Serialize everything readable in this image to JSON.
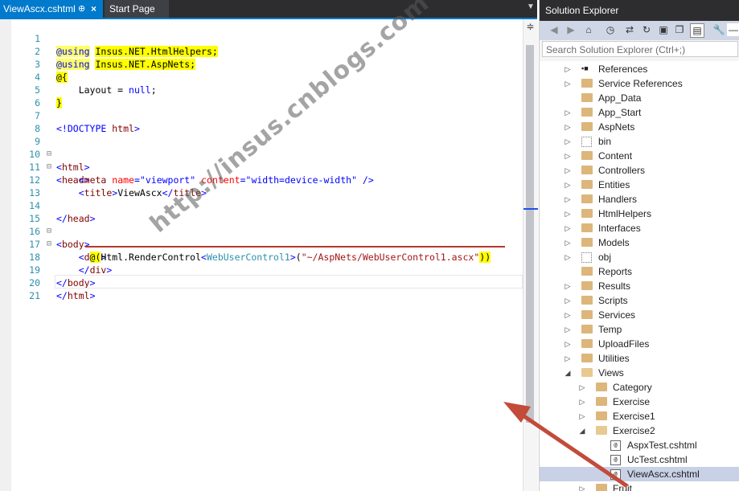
{
  "editor": {
    "active_tab": "ViewAscx.cshtml",
    "pin_glyph": "⊕",
    "close_glyph": "×",
    "second_tab": "Start Page",
    "split_glyph": "≑"
  },
  "code_lines": [
    {
      "n": "1"
    },
    {
      "n": "2"
    },
    {
      "n": "3"
    },
    {
      "n": "4"
    },
    {
      "n": "5"
    },
    {
      "n": "6"
    },
    {
      "n": "7"
    },
    {
      "n": "8"
    },
    {
      "n": "9"
    },
    {
      "n": "10"
    },
    {
      "n": "11"
    },
    {
      "n": "12"
    },
    {
      "n": "13"
    },
    {
      "n": "14"
    },
    {
      "n": "15"
    },
    {
      "n": "16"
    },
    {
      "n": "17"
    },
    {
      "n": "18"
    },
    {
      "n": "19"
    },
    {
      "n": "20"
    },
    {
      "n": "21"
    }
  ],
  "code": {
    "l1_kw": "@using",
    "l1_ns": "Insus.NET.HtmlHelpers;",
    "l2_kw": "@using",
    "l2_ns": "Insus.NET.AspNets;",
    "l3": "@{",
    "l4_a": "Layout = ",
    "l4_b": "null",
    "l4_c": ";",
    "l5": "}",
    "l7_a": "<!DOCTYPE ",
    "l7_b": "html",
    "l7_c": ">",
    "l9": "html",
    "l10": "head",
    "l11_tag": "meta",
    "l11_attr1": "name",
    "l11_val1": "\"viewport\"",
    "l11_attr2": "content",
    "l11_val2": "\"width=device-width\"",
    "l11_end": " />",
    "l12_tag": "title",
    "l12_text": "ViewAscx",
    "l14": "head",
    "l15": "body",
    "l16": "div",
    "l17_at": "@(",
    "l17_call": "Html.RenderControl",
    "l17_lt": "<",
    "l17_type": "WebUserControl1",
    "l17_gt": ">",
    "l17_open": "(",
    "l17_str": "\"~/AspNets/WebUserControl1.ascx\"",
    "l17_close": "))",
    "l18": "div",
    "l19": "body",
    "l20": "html"
  },
  "watermark": "http://insus.cnblogs.com",
  "solution_explorer": {
    "title": "Solution Explorer",
    "search_placeholder": "Search Solution Explorer (Ctrl+;)",
    "items": [
      {
        "label": "References",
        "icon": "references-icon",
        "expander": "▷"
      },
      {
        "label": "Service References",
        "icon": "folder-icon",
        "expander": "▷"
      },
      {
        "label": "App_Data",
        "icon": "folder-icon",
        "expander": ""
      },
      {
        "label": "App_Start",
        "icon": "folder-icon",
        "expander": "▷"
      },
      {
        "label": "AspNets",
        "icon": "folder-icon",
        "expander": "▷"
      },
      {
        "label": "bin",
        "icon": "dotted-folder-icon",
        "expander": "▷"
      },
      {
        "label": "Content",
        "icon": "folder-icon",
        "expander": "▷"
      },
      {
        "label": "Controllers",
        "icon": "folder-icon",
        "expander": "▷"
      },
      {
        "label": "Entities",
        "icon": "folder-icon",
        "expander": "▷"
      },
      {
        "label": "Handlers",
        "icon": "folder-icon",
        "expander": "▷"
      },
      {
        "label": "HtmlHelpers",
        "icon": "folder-icon",
        "expander": "▷"
      },
      {
        "label": "Interfaces",
        "icon": "folder-icon",
        "expander": "▷"
      },
      {
        "label": "Models",
        "icon": "folder-icon",
        "expander": "▷"
      },
      {
        "label": "obj",
        "icon": "dotted-folder-icon",
        "expander": "▷"
      },
      {
        "label": "Reports",
        "icon": "folder-icon",
        "expander": ""
      },
      {
        "label": "Results",
        "icon": "folder-icon",
        "expander": "▷"
      },
      {
        "label": "Scripts",
        "icon": "folder-icon",
        "expander": "▷"
      },
      {
        "label": "Services",
        "icon": "folder-icon",
        "expander": "▷"
      },
      {
        "label": "Temp",
        "icon": "folder-icon",
        "expander": "▷"
      },
      {
        "label": "UploadFiles",
        "icon": "folder-icon",
        "expander": "▷"
      },
      {
        "label": "Utilities",
        "icon": "folder-icon",
        "expander": "▷"
      },
      {
        "label": "Views",
        "icon": "open-folder-icon",
        "expander": "◢"
      },
      {
        "label": "Category",
        "icon": "folder-icon",
        "expander": "▷"
      },
      {
        "label": "Exercise",
        "icon": "folder-icon",
        "expander": "▷"
      },
      {
        "label": "Exercise1",
        "icon": "folder-icon",
        "expander": "▷"
      },
      {
        "label": "Exercise2",
        "icon": "open-folder-icon",
        "expander": "◢"
      },
      {
        "label": "AspxTest.cshtml",
        "icon": "cshtml-file-icon",
        "expander": ""
      },
      {
        "label": "UcTest.cshtml",
        "icon": "cshtml-file-icon",
        "expander": ""
      },
      {
        "label": "ViewAscx.cshtml",
        "icon": "cshtml-file-icon",
        "expander": ""
      },
      {
        "label": "Fruit",
        "icon": "folder-icon",
        "expander": "▷"
      }
    ]
  },
  "colors": {
    "accent": "#007acc",
    "arrow": "#c0392b",
    "highlight": "#ffff00"
  }
}
